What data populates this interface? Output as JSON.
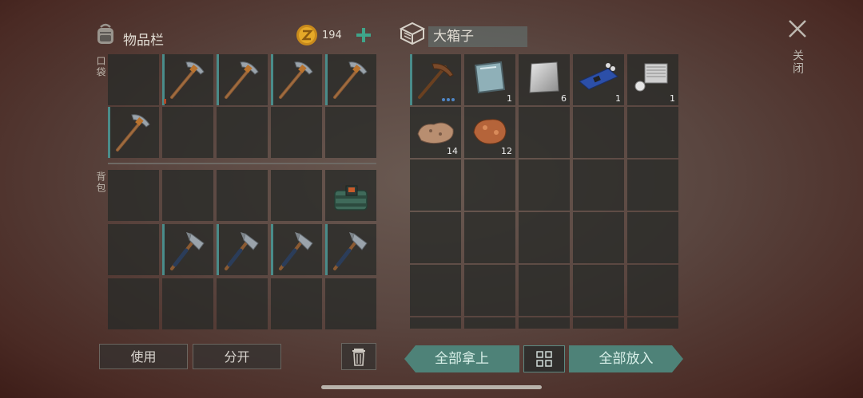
{
  "inventory": {
    "title": "物品栏",
    "coins": "194",
    "pocket_label": "口袋",
    "backpack_label": "背包",
    "use_button": "使用",
    "split_button": "分开"
  },
  "chest": {
    "title": "大箱子",
    "counts": {
      "glass": "1",
      "metal_sheet": "6",
      "circuit": "1",
      "engine": "1",
      "iron_ore": "14",
      "copper_ore": "12"
    },
    "take_all_button": "全部拿上",
    "put_all_button": "全部放入"
  },
  "close": {
    "label": "关闭"
  },
  "colors": {
    "accent_teal": "#4e8278",
    "slot_bg": "#2a2c2a"
  }
}
